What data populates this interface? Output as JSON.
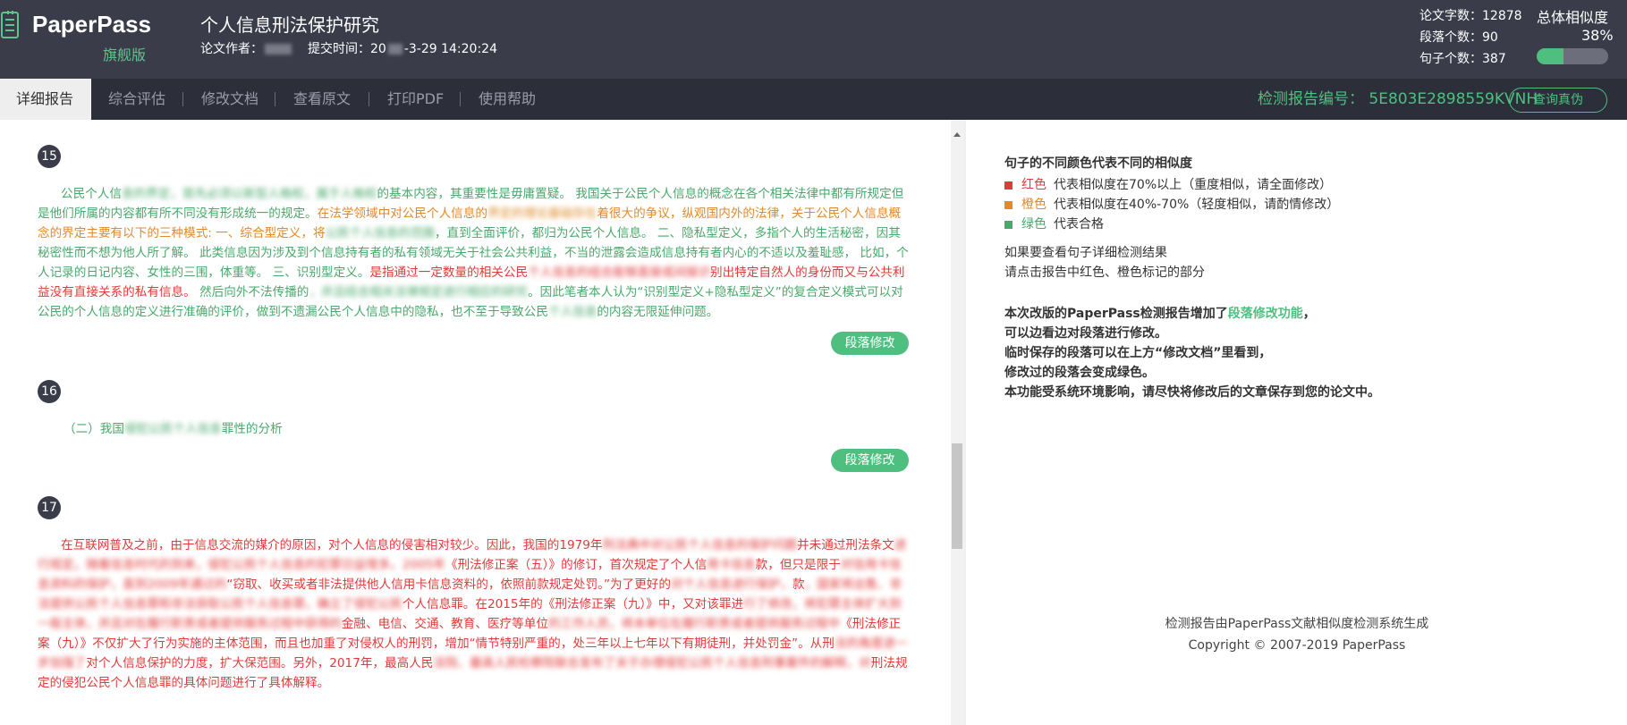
{
  "header": {
    "logo": "PaperPass",
    "logo_sub": "旗舰版",
    "doc_title": "个人信息刑法保护研究",
    "author_label": "论文作者：",
    "submit_label": "提交时间：",
    "submit_time_prefix": "20",
    "submit_time_suffix": "-3-29 14:20:24",
    "stats": {
      "words": "论文字数：12878",
      "paragraphs": "段落个数：90",
      "sentences": "句子个数：387"
    },
    "similarity_label": "总体相似度",
    "similarity_value": "38%",
    "similarity_fraction": 0.38
  },
  "nav": {
    "tabs": [
      "详细报告",
      "综合评估",
      "修改文档",
      "查看原文",
      "打印PDF",
      "使用帮助"
    ],
    "report_no": "检测报告编号： 5E803E2898559KVNH",
    "verify_button": "查询真伪"
  },
  "paragraphs": [
    {
      "num": "15",
      "segments": [
        {
          "c": "g",
          "t": "公民个人信"
        },
        {
          "c": "g",
          "t": "息的界定，首先必须以新型人格权，属于人格权",
          "blur": true
        },
        {
          "c": "g",
          "t": "的基本内容，其重要性是毋庸置疑。 我国关于公民个人信息的概念在各个相关法律中都有所规定但是他们所属的内容都有所不同没有形成统一的规定。"
        },
        {
          "c": "o",
          "t": "在法学领域中对公民个人信息的"
        },
        {
          "c": "o",
          "t": "界定的理论基础存在",
          "blur": true
        },
        {
          "c": "o",
          "t": "着很大的争议，纵观国内外的法律，关于公民个人信息概念的界定主要有以下的三种模式: 一、综合型定义，将"
        },
        {
          "c": "g",
          "t": "公民个人信息的范围",
          "blur": true
        },
        {
          "c": "g",
          "t": "，直到全面评价，都归为公民个人信息。 二、隐私型定义，多指个人的生活秘密，因其秘密性而不想为他人所了解。 此类信息因为涉及到个信息持有者的私有领域无关于社会公共利益，不当的泄露会造成信息持有者内心的不适以及羞耻感， 比如，个人记录的日记内容、女性的三围，体重等。 三、识别型定义。"
        },
        {
          "c": "r",
          "t": "是指通过一定数量的相关公民"
        },
        {
          "c": "r",
          "t": "个人信息的组合能够直接或间接识",
          "blur": true
        },
        {
          "c": "r",
          "t": "别出特定自然人的身份而又与公共利益没有直接关系的私有信息。"
        },
        {
          "c": "g",
          "t": " 然后向外不法传播的"
        },
        {
          "c": "g",
          "t": "，并且结合相关法律规定进行相应的研究",
          "blur": true
        },
        {
          "c": "g",
          "t": "。因此笔者本人认为“识别型定义+隐私型定义”的复合定义模式可以对公民的个人信息的定义进行准确的评价，做到不遗漏公民个人信息中的隐私，也不至于导致公民"
        },
        {
          "c": "g",
          "t": "个人信息",
          "blur": true
        },
        {
          "c": "g",
          "t": "的内容无限延伸问题。"
        }
      ]
    },
    {
      "num": "16",
      "segments": [
        {
          "c": "g",
          "t": "（二）我国"
        },
        {
          "c": "g",
          "t": "侵犯公民个人信息",
          "blur": true
        },
        {
          "c": "g",
          "t": "罪性的分析"
        }
      ]
    },
    {
      "num": "17",
      "segments": [
        {
          "c": "r",
          "t": "在互联网普及之前，由于信息交流的媒介的原因，对个人信息的侵害相对较少。因此，我国的1979年"
        },
        {
          "c": "r",
          "t": "刑法典中对公民个人信息的保护问题",
          "blur": true
        },
        {
          "c": "r",
          "t": "并未通过刑法条文"
        },
        {
          "c": "r",
          "t": "进行规定。随着信息时代的到来，侵犯公民个人信息的犯罪日益增多。2005年",
          "blur": true
        },
        {
          "c": "r",
          "t": "《刑法修正案（五）》的修订，首次规定了个人信"
        },
        {
          "c": "r",
          "t": "用卡信息",
          "blur": true
        },
        {
          "c": "r",
          "t": "款，但只是限于"
        },
        {
          "c": "r",
          "t": "对信用卡信息资料的保护，直到2009年通过的",
          "blur": true
        },
        {
          "c": "r",
          "t": "“窃取、收买或者非法提供他人信用卡信息资料的，依照前款规定处罚。”为了更好的"
        },
        {
          "c": "r",
          "t": "对个人信息进行保护，",
          "blur": true
        },
        {
          "c": "r",
          "t": "款"
        },
        {
          "c": "r",
          "t": "，国家将出售、非法提供公民个人信息罪和非法获取公民个人信息罪，确立了侵犯公民",
          "blur": true
        },
        {
          "c": "r",
          "t": "个人信息罪。在2015年的《刑法修正案（九）》中，又对该罪进"
        },
        {
          "c": "r",
          "t": "行了修改，将犯罪主体扩大到一般主体，并且对在履行职责或者提供服务过程中获得的",
          "blur": true
        },
        {
          "c": "r",
          "t": "金融、电信、交通、教育、医疗等单位"
        },
        {
          "c": "r",
          "t": "的工作人员，将本单位在履行职责或者提供服务过程中",
          "blur": true
        },
        {
          "c": "r",
          "t": "《刑法修正案（九）》不仅扩大了行为实施的主体范围，而且也加重了对侵权人的刑罚，增加“情节特别严重的，处三年以上七年以下有期徒刑，并处罚金”。从刑"
        },
        {
          "c": "r",
          "t": "法的角度进一步加强了",
          "blur": true
        },
        {
          "c": "r",
          "t": "对个人信息保护的力度，扩大保范围。另外，2017年，最高人民"
        },
        {
          "c": "r",
          "t": "法院、最高人民检察院联合发布了关于办理侵犯公民个人信息刑事案件的解释，对",
          "blur": true
        },
        {
          "c": "r",
          "t": "刑法规定的侵犯公民个人信息罪的具体问题进行了具体解释。"
        }
      ]
    }
  ],
  "segment_button": "段落修改",
  "legend": {
    "title": "句子的不同颜色代表不同的相似度",
    "rows": [
      {
        "color": "#e23a3a",
        "name": "红色",
        "desc": "代表相似度在70%以上（重度相似，请全面修改）"
      },
      {
        "color": "#e08a2a",
        "name": "橙色",
        "desc": "代表相似度在40%-70%（轻度相似，请酌情修改）"
      },
      {
        "color": "#4aa86c",
        "name": "绿色",
        "desc": "代表合格"
      }
    ]
  },
  "info": {
    "line1": "如果要查看句子详细检测结果",
    "line2": "请点击报告中红色、橙色标记的部分"
  },
  "notice": {
    "line1_pre": "本次改版的PaperPass检测报告增加了",
    "line1_hl": "段落修改功能",
    "line1_post": "，",
    "line2": "可以边看边对段落进行修改。",
    "line3": "临时保存的段落可以在上方“修改文档”里看到，",
    "line4": "修改过的段落会变成绿色。",
    "line5": "本功能受系统环境影响，请尽快将修改后的文章保存到您的论文中。"
  },
  "footer": {
    "line1": "检测报告由PaperPass文献相似度检测系统生成",
    "line2": "Copyright © 2007-2019 PaperPass"
  },
  "colors": {
    "header_bg": "#3a3c4a",
    "nav_bg": "#2c2e3a",
    "accent_green": "#4fbf80",
    "red": "#e23a3a",
    "orange": "#e08a2a"
  },
  "icons": {
    "logo": "document-list-icon",
    "scroll_up": "triangle-up-icon"
  }
}
